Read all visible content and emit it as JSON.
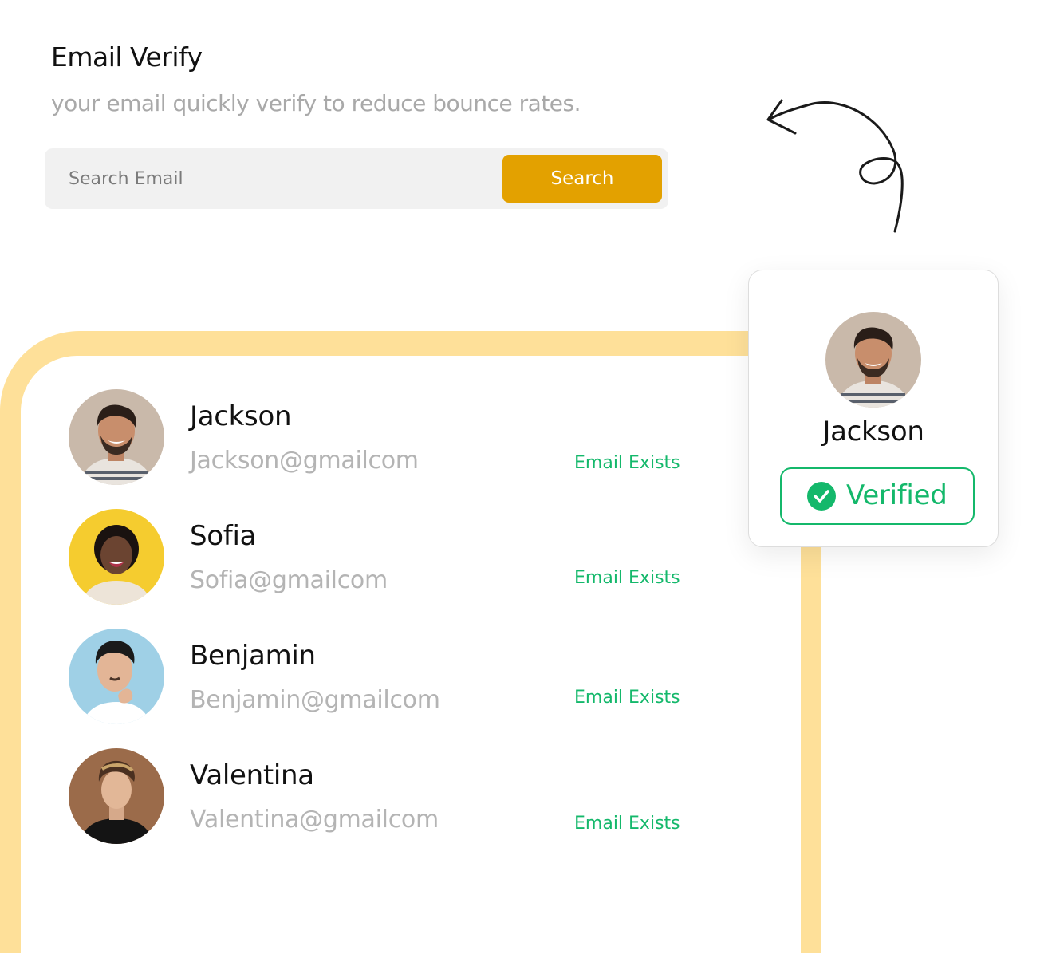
{
  "header": {
    "title": "Email Verify",
    "subtitle": "your email quickly verify to reduce bounce rates."
  },
  "search": {
    "placeholder": "Search Email",
    "value": "",
    "button_label": "Search"
  },
  "contacts": [
    {
      "name": "Jackson",
      "email": "Jackson@gmailcom",
      "status": "Email Exists",
      "avatar_icon": "avatar-photo-jackson"
    },
    {
      "name": "Sofia",
      "email": "Sofia@gmailcom",
      "status": "Email Exists",
      "avatar_icon": "avatar-photo-sofia"
    },
    {
      "name": "Benjamin",
      "email": "Benjamin@gmailcom",
      "status": "Email Exists",
      "avatar_icon": "avatar-photo-benjamin"
    },
    {
      "name": "Valentina",
      "email": "Valentina@gmailcom",
      "status": "Email Exists",
      "avatar_icon": "avatar-photo-valentina"
    }
  ],
  "verify_card": {
    "name": "Jackson",
    "badge_label": "Verified",
    "badge_icon": "check-circle-icon"
  },
  "colors": {
    "accent": "#e3a100",
    "frame": "#fee099",
    "success": "#14b86b",
    "muted_text": "#b4b4b4"
  }
}
